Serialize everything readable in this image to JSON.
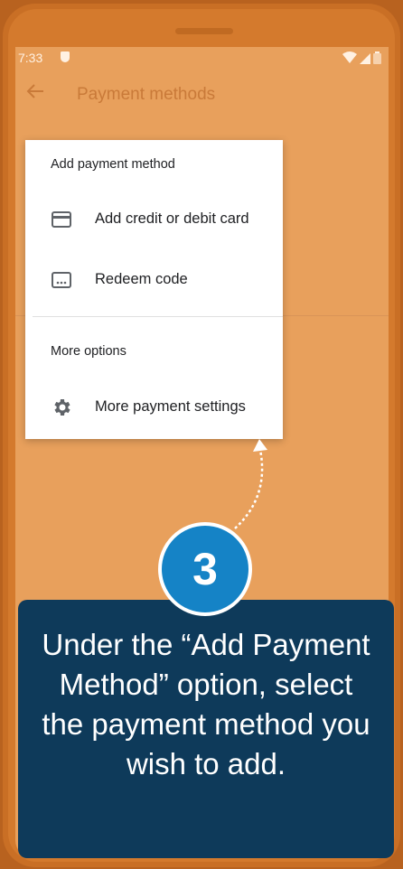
{
  "status_bar": {
    "time": "7:33",
    "icons": [
      "shield-icon",
      "wifi-icon",
      "signal-icon",
      "battery-icon"
    ]
  },
  "app_bar": {
    "back_icon": "arrow-back-icon",
    "title": "Payment methods"
  },
  "menu": {
    "section_add_title": "Add payment method",
    "add_items": [
      {
        "icon": "credit-card-icon",
        "label": "Add credit or debit card"
      },
      {
        "icon": "redeem-code-icon",
        "label": "Redeem code"
      }
    ],
    "section_more_title": "More options",
    "more_items": [
      {
        "icon": "gear-icon",
        "label": "More payment settings"
      }
    ]
  },
  "step": {
    "number": "3",
    "instruction": "Under the “Add Payment Method” option, select the payment method you wish to add."
  },
  "colors": {
    "overlay_orange": "#e8a05c",
    "callout_navy": "#0e3a5a",
    "step_blue": "#1583c6"
  }
}
